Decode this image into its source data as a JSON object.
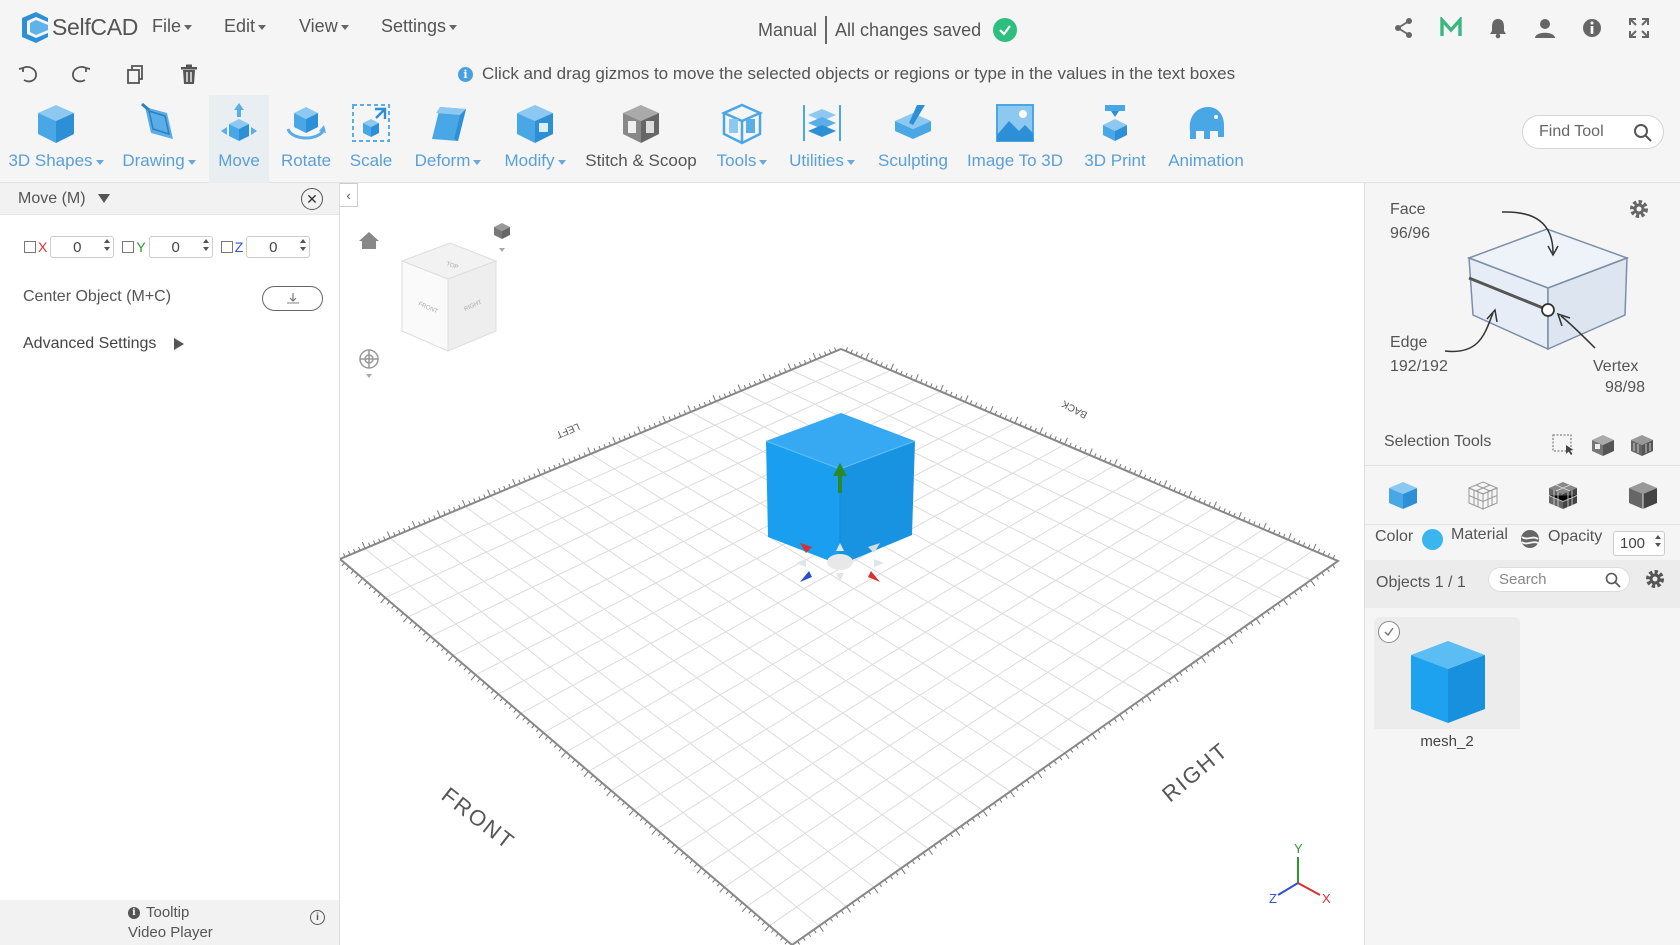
{
  "app": {
    "name": "SelfCAD"
  },
  "menus": [
    "File",
    "Edit",
    "View",
    "Settings"
  ],
  "status": {
    "mode": "Manual",
    "saved": "All changes saved"
  },
  "hint": "Click and drag gizmos to move the selected objects or regions or type in the values in the text boxes",
  "tools": [
    {
      "label": "3D Shapes",
      "dropdown": true
    },
    {
      "label": "Drawing",
      "dropdown": true
    },
    {
      "label": "Move",
      "dropdown": false,
      "active": true
    },
    {
      "label": "Rotate",
      "dropdown": false
    },
    {
      "label": "Scale",
      "dropdown": false
    },
    {
      "label": "Deform",
      "dropdown": true
    },
    {
      "label": "Modify",
      "dropdown": true
    },
    {
      "label": "Stitch & Scoop",
      "dropdown": false
    },
    {
      "label": "Tools",
      "dropdown": true
    },
    {
      "label": "Utilities",
      "dropdown": true
    },
    {
      "label": "Sculpting",
      "dropdown": false
    },
    {
      "label": "Image To 3D",
      "dropdown": false
    },
    {
      "label": "3D Print",
      "dropdown": false
    },
    {
      "label": "Animation",
      "dropdown": false
    }
  ],
  "find_tool": {
    "placeholder": "Find Tool"
  },
  "left_panel": {
    "title": "Move (M)",
    "x_label": "X",
    "x_value": "0",
    "y_label": "Y",
    "y_value": "0",
    "z_label": "Z",
    "z_value": "0",
    "center_object": "Center Object (M+C)",
    "advanced": "Advanced Settings",
    "footer_line1": "Tooltip",
    "footer_line2": "Video Player"
  },
  "viewport": {
    "labels": {
      "front": "FRONT",
      "right": "RIGHT",
      "left": "LEFT",
      "back": "BACK"
    },
    "nav_cube": {
      "top": "TOP",
      "front": "FRONT",
      "right": "RIGHT"
    },
    "axes": {
      "x": "X",
      "y": "Y",
      "z": "Z"
    },
    "object_color": "#1a9ff0"
  },
  "right_panel": {
    "face_label": "Face",
    "face_count": "96/96",
    "edge_label": "Edge",
    "edge_count": "192/192",
    "vertex_label": "Vertex",
    "vertex_count": "98/98",
    "selection_tools": "Selection Tools",
    "color_label": "Color",
    "color_value": "#3bb5ee",
    "material_label": "Material",
    "opacity_label": "Opacity",
    "opacity_value": "100",
    "objects_label": "Objects 1 / 1",
    "search_placeholder": "Search",
    "objects": [
      {
        "name": "mesh_2"
      }
    ]
  },
  "colors": {
    "accent": "#5aa0d8",
    "saved": "#2ebf7e",
    "object": "#1a9ff0"
  }
}
